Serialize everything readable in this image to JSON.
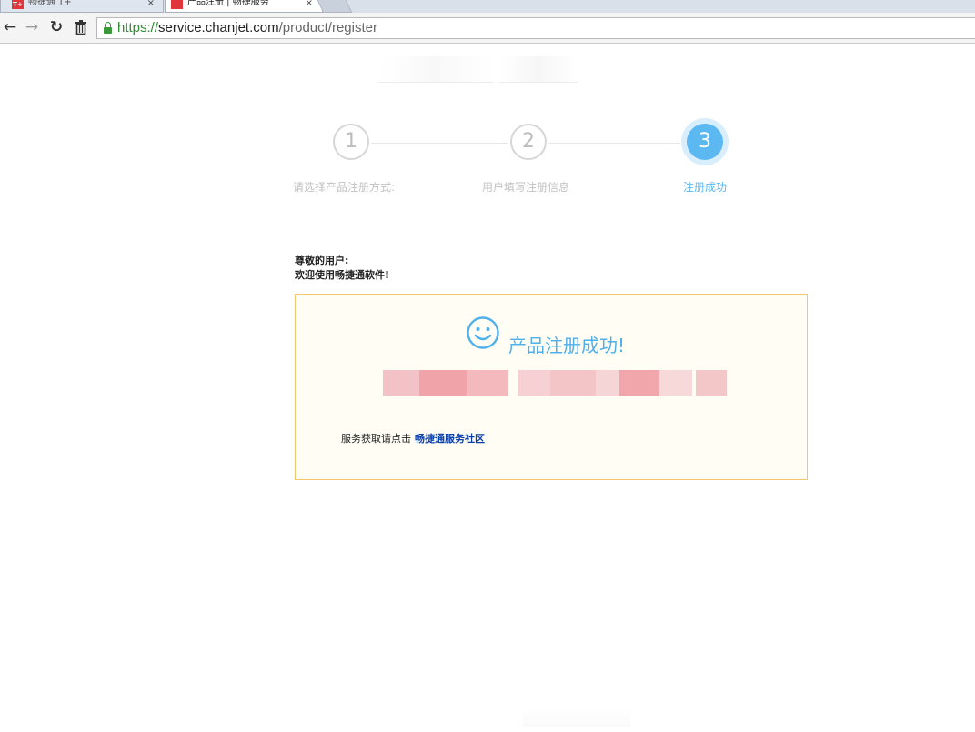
{
  "browser": {
    "tabs": [
      {
        "title": "畅捷通 T+",
        "favicon": "T+",
        "active": false
      },
      {
        "title": "产品注册 | 畅捷服务",
        "favicon": "",
        "active": true
      }
    ],
    "close_glyph": "×",
    "url": {
      "scheme": "https://",
      "host": "service.chanjet.com",
      "path": "/product/register"
    },
    "icons": [
      "back-arrow-icon",
      "forward-arrow-icon",
      "reload-icon",
      "trash-icon",
      "lock-icon"
    ]
  },
  "steps": [
    {
      "number": "1",
      "label": "请选择产品注册方式:",
      "state": "done"
    },
    {
      "number": "2",
      "label": "用户填写注册信息",
      "state": "done"
    },
    {
      "number": "3",
      "label": "注册成功",
      "state": "current"
    }
  ],
  "greeting": {
    "line1": "尊敬的用户:",
    "line2": "欢迎使用畅捷通软件!"
  },
  "success": {
    "title": "产品注册成功!",
    "service_text": "服务获取请点击",
    "service_link": "畅捷通服务社区"
  },
  "colors": {
    "accent": "#5bb8f0",
    "box_border": "#f2c66b",
    "box_bg": "#fffdf4",
    "link": "#0b3fa8"
  }
}
